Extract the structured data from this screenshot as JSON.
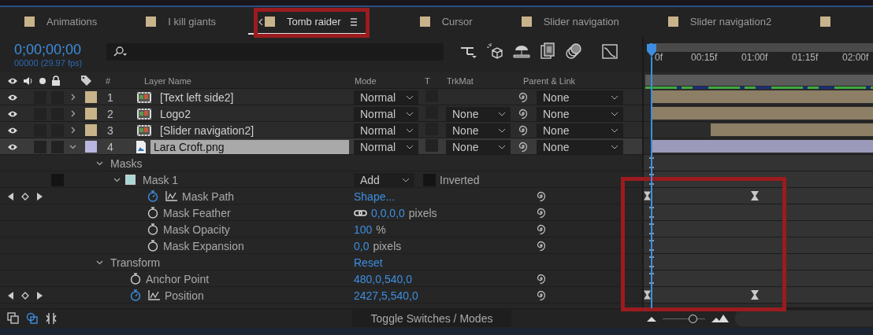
{
  "tabs": [
    {
      "label": "Animations",
      "selected": false
    },
    {
      "label": "I kill giants",
      "selected": false
    },
    {
      "label": "Tomb raider",
      "selected": true
    },
    {
      "label": "Cursor",
      "selected": false
    },
    {
      "label": "Slider navigation",
      "selected": false
    },
    {
      "label": "Slider navigation2",
      "selected": false
    },
    {
      "selected": false
    }
  ],
  "timecode": "0;00;00;00",
  "frame_info": "00000 (29.97 fps)",
  "ruler": [
    "0f",
    "00:15f",
    "01:00f",
    "01:15f",
    "02:00f"
  ],
  "columns": {
    "number": "#",
    "layer_name": "Layer Name",
    "mode": "Mode",
    "t": "T",
    "trkmat": "TrkMat",
    "parent": "Parent & Link"
  },
  "layers": [
    {
      "number": "1",
      "name": "[Text left side2]",
      "kind": "comp",
      "color": "#c8b38b",
      "mode": "Normal",
      "parent": "None",
      "selected": false,
      "expanded": false,
      "trimmed_start": false
    },
    {
      "number": "2",
      "name": "Logo2",
      "kind": "comp",
      "color": "#c8b38b",
      "mode": "Normal",
      "trkmat": "None",
      "parent": "None",
      "selected": false,
      "expanded": false,
      "trimmed_start": false
    },
    {
      "number": "3",
      "name": "[Slider navigation2]",
      "kind": "comp",
      "color": "#c8b38b",
      "mode": "Normal",
      "trkmat": "None",
      "parent": "None",
      "selected": false,
      "expanded": false,
      "trimmed_start": true
    },
    {
      "number": "4",
      "name": "Lara Croft.png",
      "kind": "image",
      "color": "#b9b6e0",
      "mode": "Normal",
      "trkmat": "None",
      "parent": "None",
      "selected": true,
      "expanded": true,
      "trimmed_start": false,
      "children": [
        {
          "kind": "group",
          "name": "Masks",
          "expanded": true,
          "children": [
            {
              "kind": "mask",
              "name": "Mask 1",
              "color": "#a9d6d3",
              "mode": "Add",
              "inverted_label": "Inverted",
              "inverted": false,
              "expanded": true,
              "children": [
                {
                  "kind": "property",
                  "name": "Mask Path",
                  "value": "Shape...",
                  "animated": true
                },
                {
                  "kind": "property",
                  "name": "Mask Feather",
                  "value": "0,0,0,0",
                  "unit": "pixels",
                  "linked": true,
                  "animated": false
                },
                {
                  "kind": "property",
                  "name": "Mask Opacity",
                  "value": "100",
                  "unit": "%",
                  "animated": false
                },
                {
                  "kind": "property",
                  "name": "Mask Expansion",
                  "value": "0,0",
                  "unit": "pixels",
                  "animated": false
                }
              ]
            }
          ]
        },
        {
          "kind": "group",
          "name": "Transform",
          "value": "Reset",
          "expanded": true,
          "children": [
            {
              "kind": "property",
              "name": "Anchor Point",
              "value": "480,0,540,0",
              "animated": false
            },
            {
              "kind": "property",
              "name": "Position",
              "value": "2427,5,540,0",
              "animated": true
            }
          ]
        }
      ]
    }
  ],
  "toggle_label": "Toggle Switches / Modes",
  "zoom": {
    "level": 0.72
  }
}
